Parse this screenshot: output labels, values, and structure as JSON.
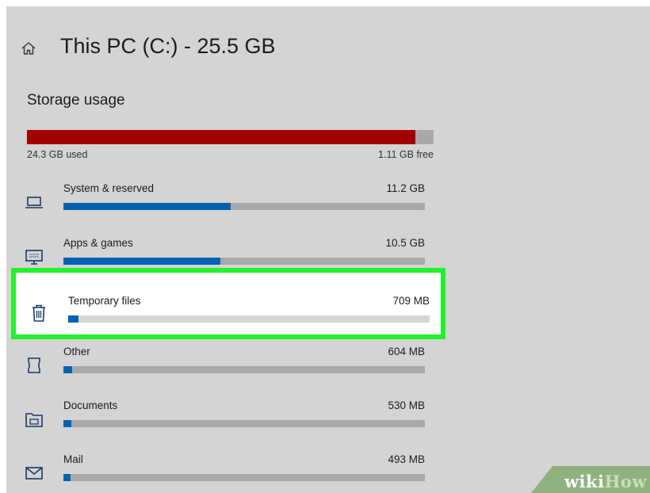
{
  "header": {
    "title": "This PC (C:) - 25.5 GB",
    "home_icon": "home-icon"
  },
  "storage": {
    "section_title": "Storage usage",
    "used_label": "24.3 GB used",
    "free_label": "1.11 GB free",
    "used_fraction": 0.956
  },
  "categories": [
    {
      "label": "System & reserved",
      "size": "11.2 GB",
      "fraction": 0.463,
      "icon": "laptop-icon"
    },
    {
      "label": "Apps & games",
      "size": "10.5 GB",
      "fraction": 0.435,
      "icon": "monitor-keyboard-icon"
    },
    {
      "label": "Temporary files",
      "size": "709 MB",
      "fraction": 0.028,
      "icon": "trash-icon",
      "highlighted": true
    },
    {
      "label": "Other",
      "size": "604 MB",
      "fraction": 0.024,
      "icon": "other-doc-icon"
    },
    {
      "label": "Documents",
      "size": "530 MB",
      "fraction": 0.022,
      "icon": "folder-icon"
    },
    {
      "label": "Mail",
      "size": "493 MB",
      "fraction": 0.02,
      "icon": "mail-icon"
    }
  ],
  "colors": {
    "used_bar": "#a30000",
    "category_bar": "#0063b1",
    "highlight_border": "#22f22b",
    "panel_bg": "#d4d4d4"
  },
  "watermark": {
    "wiki": "wiki",
    "how": "How"
  }
}
